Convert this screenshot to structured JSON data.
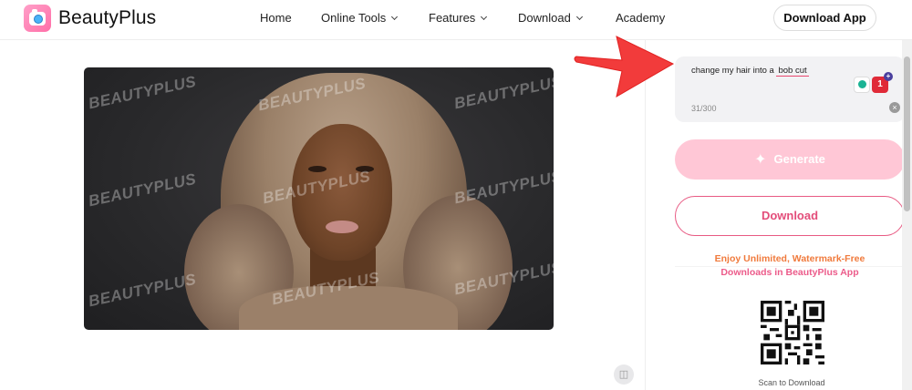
{
  "header": {
    "brand": "BeautyPlus",
    "nav": [
      {
        "label": "Home"
      },
      {
        "label": "Online Tools"
      },
      {
        "label": "Features"
      },
      {
        "label": "Download"
      },
      {
        "label": "Academy"
      }
    ],
    "download_app_label": "Download App"
  },
  "image": {
    "watermark": "BEAUTYPLUS"
  },
  "prompt": {
    "text_before": "change my hair into a ",
    "highlight": "bob cut",
    "counter": "31/300",
    "ext_badge": "1"
  },
  "actions": {
    "generate_label": "Generate",
    "download_label": "Download"
  },
  "promo": {
    "line1": "Enjoy Unlimited, Watermark-Free",
    "line2": "Downloads in  BeautyPlus App",
    "scan_label": "Scan to Download"
  },
  "colors": {
    "accent_pink": "#e34d7a",
    "generate_bg": "#ffc7d6",
    "arrow_red": "#f23b3b"
  }
}
